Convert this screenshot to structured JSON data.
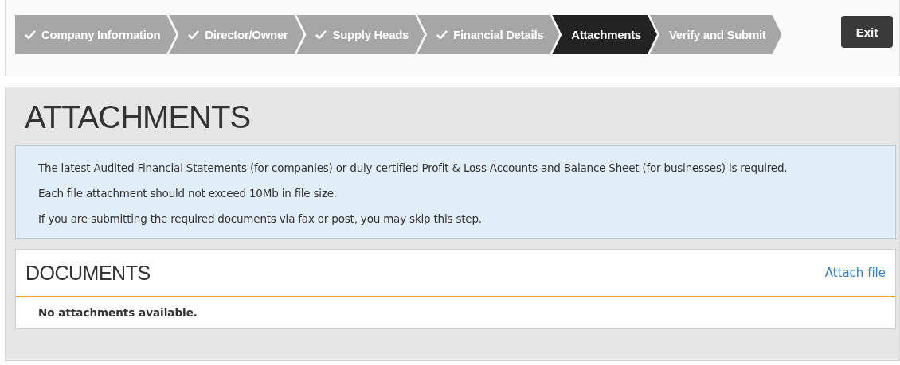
{
  "steps": [
    {
      "label": "Company Information",
      "done": true,
      "selected": false
    },
    {
      "label": "Director/Owner",
      "done": true,
      "selected": false
    },
    {
      "label": "Supply Heads",
      "done": true,
      "selected": false
    },
    {
      "label": "Financial Details",
      "done": true,
      "selected": false
    },
    {
      "label": "Attachments",
      "done": false,
      "selected": true
    },
    {
      "label": "Verify and Submit",
      "done": false,
      "selected": false
    }
  ],
  "exit_button": "Exit",
  "title": "ATTACHMENTS",
  "notice": [
    "The latest Audited Financial Statements (for companies) or duly certified Profit & Loss Accounts and Balance Sheet (for businesses) is required.",
    "Each file attachment should not exceed 10Mb in file size.",
    "If you are submitting the required documents via fax or post, you may skip this step."
  ],
  "documents": {
    "title": "DOCUMENTS",
    "attach_link": "Attach file",
    "empty_message": "No attachments available."
  }
}
